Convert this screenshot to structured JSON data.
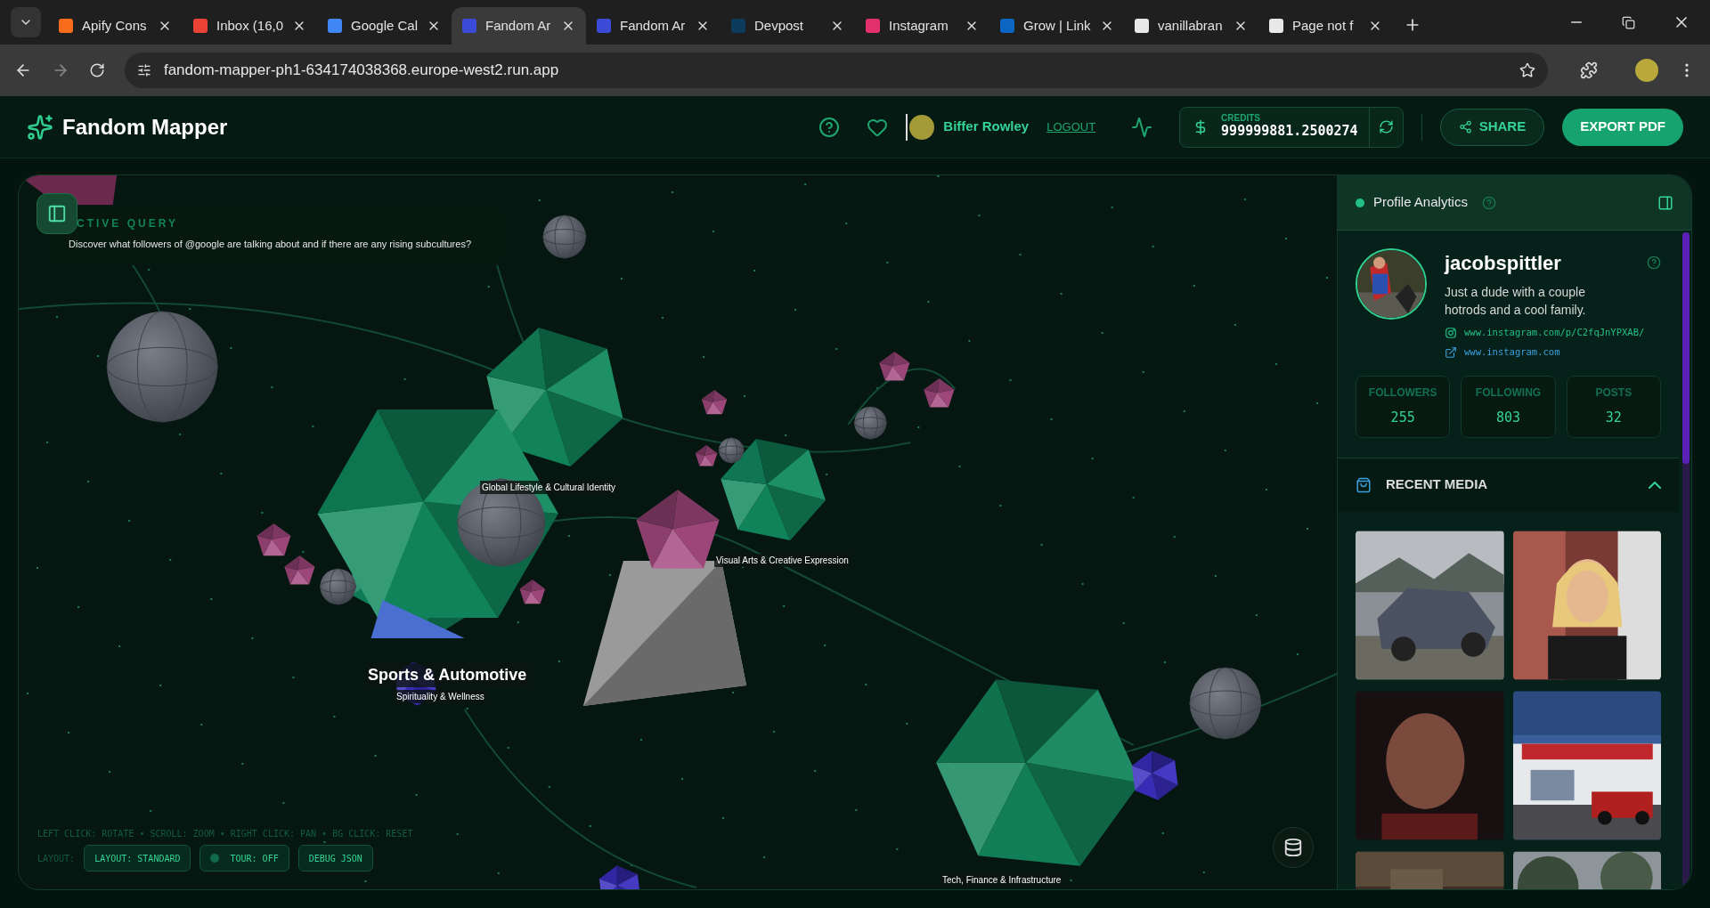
{
  "browser": {
    "tabs": [
      {
        "title": "Apify Cons",
        "color": "#f86c1b",
        "selected": false
      },
      {
        "title": "Inbox (16,0",
        "color": "#ea4335",
        "selected": false
      },
      {
        "title": "Google Cal",
        "color": "#4285f4",
        "selected": false
      },
      {
        "title": "Fandom Ar",
        "color": "#3b4bd8",
        "selected": true
      },
      {
        "title": "Fandom Ar",
        "color": "#3b4bd8",
        "selected": false
      },
      {
        "title": "Devpost",
        "color": "#0d3b5c",
        "selected": false
      },
      {
        "title": "Instagram",
        "color": "#e1306c",
        "selected": false
      },
      {
        "title": "Grow | Link",
        "color": "#0a66c2",
        "selected": false
      },
      {
        "title": "vanillabran",
        "color": "#e8e8e8",
        "selected": false
      },
      {
        "title": "Page not f",
        "color": "#e8e8e8",
        "selected": false
      }
    ],
    "url": "fandom-mapper-ph1-634174038368.europe-west2.run.app"
  },
  "header": {
    "title": "Fandom Mapper",
    "user": "Biffer Rowley",
    "logout": "LOGOUT",
    "credits_label": "CREDITS",
    "credits": "999999881.2500274",
    "share": "SHARE",
    "export": "EXPORT PDF"
  },
  "canvas": {
    "query_label": "CTIVE QUERY",
    "query": "Discover what followers of @google are talking about and if there are any rising subcultures?",
    "labels": [
      {
        "text": "Global Lifestyle & Cultural Identity",
        "kind": "minor"
      },
      {
        "text": "Visual Arts & Creative Expression",
        "kind": "minor"
      },
      {
        "text": "Sports & Automotive",
        "kind": "major"
      },
      {
        "text": "Spirituality & Wellness",
        "kind": "minor"
      },
      {
        "text": "Tech, Finance & Infrastructure",
        "kind": "minor"
      }
    ],
    "hint": "LEFT CLICK: ROTATE • SCROLL: ZOOM • RIGHT CLICK: PAN • BG CLICK: RESET",
    "layout_label": "LAYOUT:",
    "controls": [
      {
        "label": "LAYOUT: STANDARD",
        "kind": "button"
      },
      {
        "label": "TOUR: OFF",
        "kind": "toggle",
        "on": false
      },
      {
        "label": "DEBUG JSON",
        "kind": "button"
      }
    ]
  },
  "panel": {
    "title": "Profile Analytics",
    "username": "jacobspittler",
    "bio": "Just a dude with a couple hotrods and a cool family.",
    "links": [
      {
        "text": "www.instagram.com/p/C2fqJnYPXAB/",
        "kind": "instagram"
      },
      {
        "text": "www.instagram.com",
        "kind": "external"
      }
    ],
    "stats": [
      {
        "label": "FOLLOWERS",
        "value": "255"
      },
      {
        "label": "FOLLOWING",
        "value": "803"
      },
      {
        "label": "POSTS",
        "value": "32"
      }
    ],
    "section": {
      "title": "RECENT MEDIA",
      "expanded": true
    },
    "media": [
      {
        "kind": "car"
      },
      {
        "kind": "person"
      },
      {
        "kind": "portrait"
      },
      {
        "kind": "building"
      },
      {
        "kind": "dark"
      },
      {
        "kind": "trees"
      }
    ]
  }
}
